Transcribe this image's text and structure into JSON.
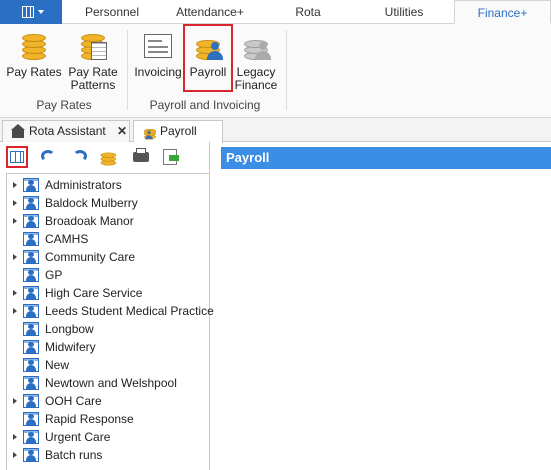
{
  "top_tabs": [
    "Personnel",
    "Attendance+",
    "Rota",
    "Utilities",
    "Finance+"
  ],
  "active_top_tab": "Finance+",
  "ribbon": {
    "buttons": [
      {
        "line1": "Pay Rates",
        "line2": "",
        "icon": "coins-icon"
      },
      {
        "line1": "Pay Rate",
        "line2": "Patterns",
        "icon": "pay-rate-patterns-icon"
      },
      {
        "line1": "Invoicing",
        "line2": "",
        "icon": "invoice-icon"
      },
      {
        "line1": "Payroll",
        "line2": "",
        "icon": "payroll-icon"
      },
      {
        "line1": "Legacy",
        "line2": "Finance",
        "icon": "legacy-finance-icon"
      }
    ],
    "groups": [
      "Pay Rates",
      "Payroll and Invoicing"
    ]
  },
  "doc_tabs": [
    {
      "label": "Rota Assistant",
      "icon": "home-icon",
      "close": "✕"
    },
    {
      "label": "Payroll",
      "icon": "payroll-icon",
      "close": ""
    }
  ],
  "toolbar_icons": [
    "grid-view-icon",
    "undo-icon",
    "refresh-icon",
    "coins-export-icon",
    "print-icon",
    "export-icon"
  ],
  "tree": [
    {
      "label": "Administrators",
      "expandable": true
    },
    {
      "label": "Baldock Mulberry",
      "expandable": true
    },
    {
      "label": "Broadoak Manor",
      "expandable": true
    },
    {
      "label": "CAMHS",
      "expandable": false
    },
    {
      "label": "Community Care",
      "expandable": true
    },
    {
      "label": "GP",
      "expandable": false
    },
    {
      "label": "High Care Service",
      "expandable": true
    },
    {
      "label": "Leeds Student Medical Practice",
      "expandable": true
    },
    {
      "label": "Longbow",
      "expandable": false
    },
    {
      "label": "Midwifery",
      "expandable": false
    },
    {
      "label": "New",
      "expandable": false
    },
    {
      "label": "Newtown and Welshpool",
      "expandable": false
    },
    {
      "label": "OOH Care",
      "expandable": true
    },
    {
      "label": "Rapid Response",
      "expandable": false
    },
    {
      "label": "Urgent Care",
      "expandable": true
    },
    {
      "label": "Batch runs",
      "expandable": true
    }
  ],
  "right_panel": {
    "header": "Payroll"
  },
  "colors": {
    "accent": "#2b6fc4",
    "header": "#3a8ee6",
    "highlight": "#d9252e"
  }
}
